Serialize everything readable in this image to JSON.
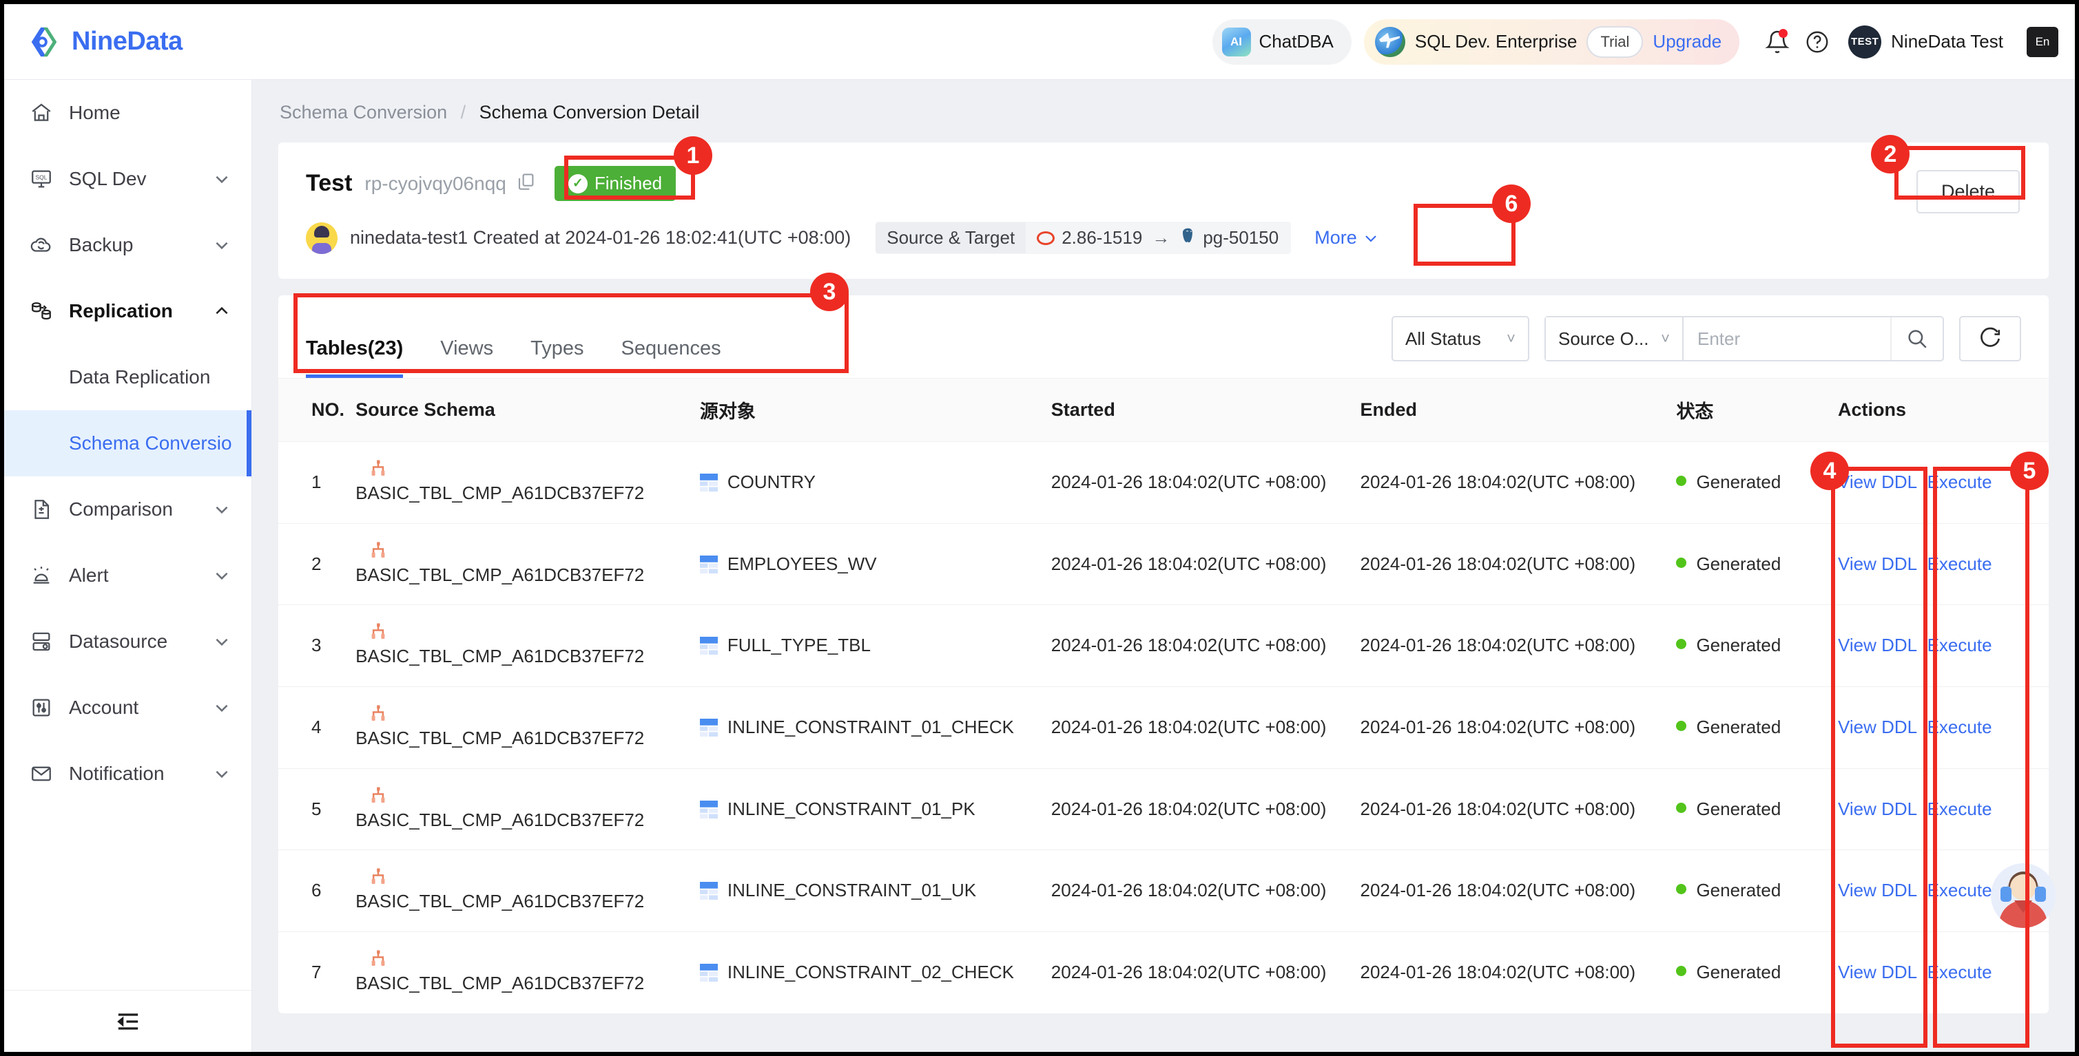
{
  "brand": {
    "name": "NineData"
  },
  "topbar": {
    "chat_label": "ChatDBA",
    "chat_icon_text": "AI",
    "enterprise_label": "SQL Dev. Enterprise",
    "trial_label": "Trial",
    "upgrade_label": "Upgrade",
    "avatar_initials": "TEST",
    "user_name": "NineData Test",
    "lang_label": "En"
  },
  "sidebar": {
    "items": [
      {
        "label": "Home",
        "icon": "home-icon",
        "expandable": false
      },
      {
        "label": "SQL Dev",
        "icon": "sql-dev-icon",
        "expandable": true
      },
      {
        "label": "Backup",
        "icon": "backup-cloud-icon",
        "expandable": true
      },
      {
        "label": "Replication",
        "icon": "replication-icon",
        "expandable": true,
        "expanded": true,
        "active": true
      },
      {
        "label": "Comparison",
        "icon": "comparison-icon",
        "expandable": true
      },
      {
        "label": "Alert",
        "icon": "alert-icon",
        "expandable": true
      },
      {
        "label": "Datasource",
        "icon": "datasource-icon",
        "expandable": true
      },
      {
        "label": "Account",
        "icon": "account-icon",
        "expandable": true
      },
      {
        "label": "Notification",
        "icon": "notification-mail-icon",
        "expandable": true
      }
    ],
    "sub_items": [
      {
        "label": "Data Replication",
        "selected": false
      },
      {
        "label": "Schema Conversio",
        "selected": true
      }
    ],
    "collapse_icon": "collapse-sidebar-icon"
  },
  "breadcrumb": {
    "parent": "Schema Conversion",
    "separator": "/",
    "current": "Schema Conversion Detail"
  },
  "detail": {
    "task_name": "Test",
    "task_id": "rp-cyojvqy06nqq",
    "status_badge": "Finished",
    "status_color": "#4caf37",
    "creator": "ninedata-test1 Created at 2024-01-26 18:02:41(UTC +08:00)",
    "source_target_label": "Source & Target",
    "source_name": "2.86-1519",
    "target_name": "pg-50150",
    "arrow": "→",
    "more_label": "More",
    "delete_label": "Delete"
  },
  "tabs": [
    {
      "label": "Tables(23)",
      "active": true
    },
    {
      "label": "Views",
      "active": false
    },
    {
      "label": "Types",
      "active": false
    },
    {
      "label": "Sequences",
      "active": false
    }
  ],
  "filters": {
    "status_select": "All Status",
    "object_select": "Source O...",
    "search_placeholder": "Enter",
    "search_value": "",
    "search_icon": "search-icon",
    "refresh_icon": "refresh-icon"
  },
  "table": {
    "columns": [
      "NO.",
      "Source Schema",
      "源对象",
      "Started",
      "Ended",
      "状态",
      "Actions"
    ],
    "rows": [
      {
        "no": "1",
        "schema": "BASIC_TBL_CMP_A61DCB37EF72",
        "object": "COUNTRY",
        "started": "2024-01-26 18:04:02(UTC +08:00)",
        "ended": "2024-01-26 18:04:02(UTC +08:00)",
        "status": "Generated",
        "action_view": "View DDL",
        "action_exec": "Execute"
      },
      {
        "no": "2",
        "schema": "BASIC_TBL_CMP_A61DCB37EF72",
        "object": "EMPLOYEES_WV",
        "started": "2024-01-26 18:04:02(UTC +08:00)",
        "ended": "2024-01-26 18:04:02(UTC +08:00)",
        "status": "Generated",
        "action_view": "View DDL",
        "action_exec": "Execute"
      },
      {
        "no": "3",
        "schema": "BASIC_TBL_CMP_A61DCB37EF72",
        "object": "FULL_TYPE_TBL",
        "started": "2024-01-26 18:04:02(UTC +08:00)",
        "ended": "2024-01-26 18:04:02(UTC +08:00)",
        "status": "Generated",
        "action_view": "View DDL",
        "action_exec": "Execute"
      },
      {
        "no": "4",
        "schema": "BASIC_TBL_CMP_A61DCB37EF72",
        "object": "INLINE_CONSTRAINT_01_CHECK",
        "started": "2024-01-26 18:04:02(UTC +08:00)",
        "ended": "2024-01-26 18:04:02(UTC +08:00)",
        "status": "Generated",
        "action_view": "View DDL",
        "action_exec": "Execute"
      },
      {
        "no": "5",
        "schema": "BASIC_TBL_CMP_A61DCB37EF72",
        "object": "INLINE_CONSTRAINT_01_PK",
        "started": "2024-01-26 18:04:02(UTC +08:00)",
        "ended": "2024-01-26 18:04:02(UTC +08:00)",
        "status": "Generated",
        "action_view": "View DDL",
        "action_exec": "Execute"
      },
      {
        "no": "6",
        "schema": "BASIC_TBL_CMP_A61DCB37EF72",
        "object": "INLINE_CONSTRAINT_01_UK",
        "started": "2024-01-26 18:04:02(UTC +08:00)",
        "ended": "2024-01-26 18:04:02(UTC +08:00)",
        "status": "Generated",
        "action_view": "View DDL",
        "action_exec": "Execute"
      },
      {
        "no": "7",
        "schema": "BASIC_TBL_CMP_A61DCB37EF72",
        "object": "INLINE_CONSTRAINT_02_CHECK",
        "started": "2024-01-26 18:04:02(UTC +08:00)",
        "ended": "2024-01-26 18:04:02(UTC +08:00)",
        "status": "Generated",
        "action_view": "View DDL",
        "action_exec": "Execute"
      }
    ]
  },
  "annotations": [
    {
      "num": "1"
    },
    {
      "num": "2"
    },
    {
      "num": "3"
    },
    {
      "num": "4"
    },
    {
      "num": "5"
    },
    {
      "num": "6"
    }
  ],
  "colors": {
    "accent": "#3a6df0",
    "success": "#4caf37",
    "annotation": "#ee2b22",
    "status_dot": "#52c41a"
  }
}
